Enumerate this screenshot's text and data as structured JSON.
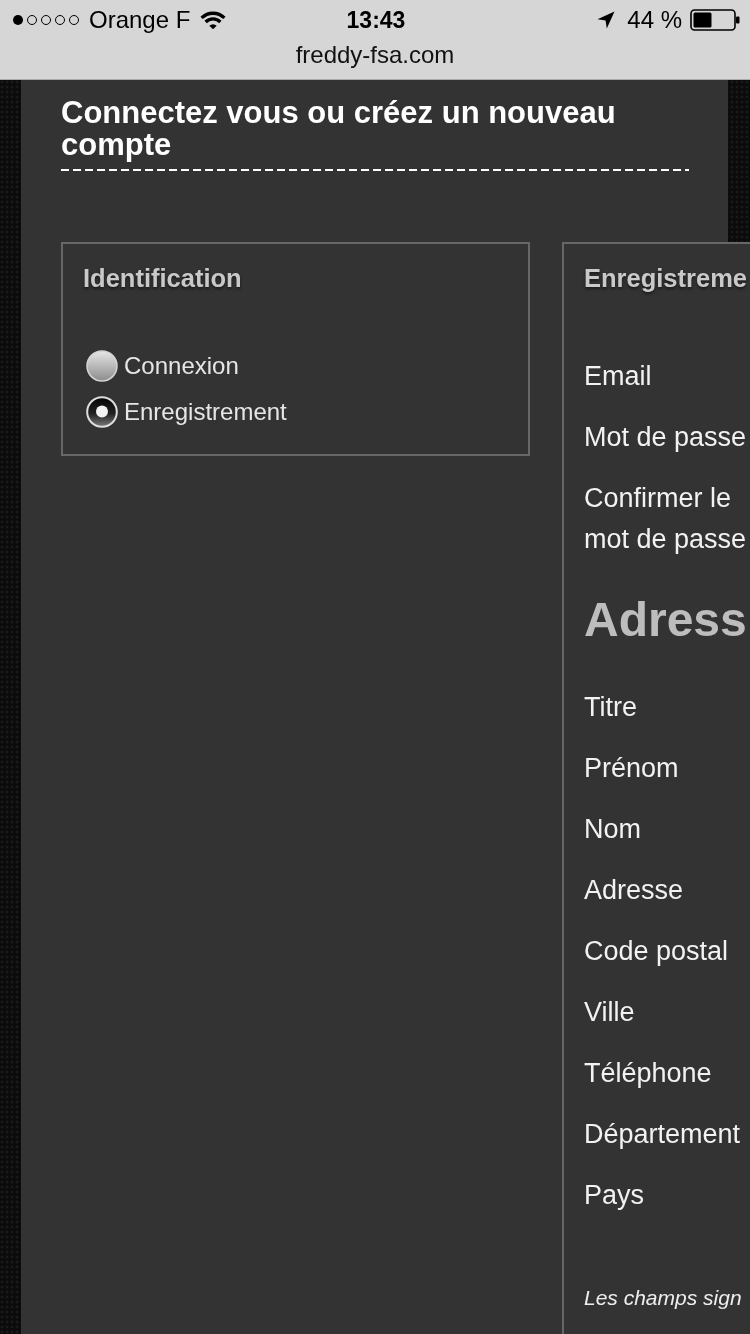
{
  "status_bar": {
    "carrier": "Orange F",
    "time": "13:43",
    "battery": "44 %"
  },
  "browser": {
    "url": "freddy-fsa.com"
  },
  "page": {
    "title": "Connectez vous ou créez un nouveau compte"
  },
  "identification": {
    "title": "Identification",
    "options": [
      {
        "label": "Connexion",
        "selected": false
      },
      {
        "label": "Enregistrement",
        "selected": true
      }
    ]
  },
  "registration": {
    "title": "Enregistreme",
    "rows": [
      {
        "kind": "field",
        "label": "Email"
      },
      {
        "kind": "field",
        "label": "Mot de passe"
      },
      {
        "kind": "field",
        "label": "Confirmer le mot de passe"
      },
      {
        "kind": "heading",
        "label": "Adress"
      },
      {
        "kind": "field",
        "label": "Titre"
      },
      {
        "kind": "field",
        "label": "Prénom"
      },
      {
        "kind": "field",
        "label": "Nom"
      },
      {
        "kind": "field",
        "label": "Adresse"
      },
      {
        "kind": "field",
        "label": "Code postal"
      },
      {
        "kind": "field",
        "label": "Ville"
      },
      {
        "kind": "field",
        "label": "Téléphone"
      },
      {
        "kind": "field",
        "label": "Département"
      },
      {
        "kind": "field",
        "label": "Pays"
      },
      {
        "kind": "note",
        "label": "Les champs sign"
      }
    ]
  }
}
